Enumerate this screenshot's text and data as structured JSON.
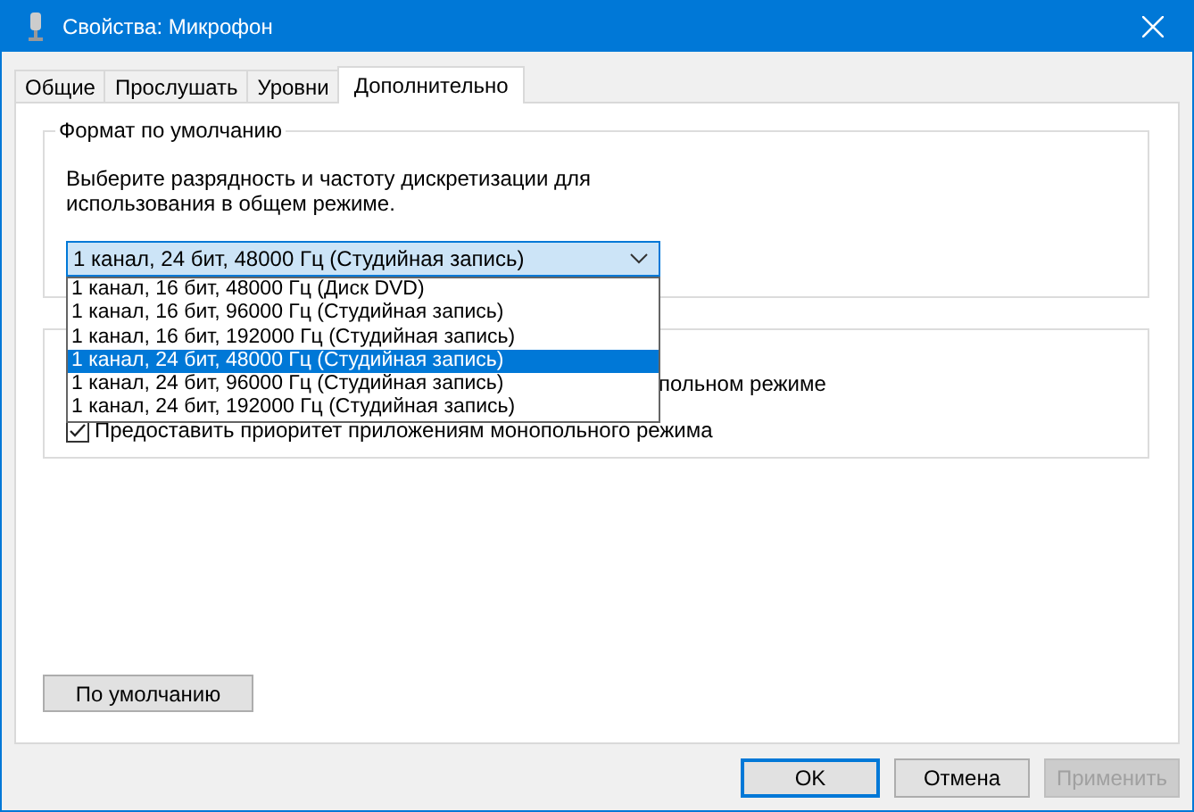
{
  "window": {
    "title": "Свойства: Микрофон"
  },
  "tabs": [
    {
      "label": "Общие",
      "selected": false
    },
    {
      "label": "Прослушать",
      "selected": false
    },
    {
      "label": "Уровни",
      "selected": false
    },
    {
      "label": "Дополнительно",
      "selected": true
    }
  ],
  "default_format": {
    "title": "Формат по умолчанию",
    "description": "Выберите разрядность и частоту дискретизации для использования в общем режиме.",
    "value": "1 канал, 24 бит, 48000 Гц (Студийная запись)",
    "expanded": true,
    "options": [
      {
        "label": "1 канал, 16 бит, 48000 Гц (Диск DVD)",
        "selected": false
      },
      {
        "label": "1 канал, 16 бит, 96000 Гц (Студийная запись)",
        "selected": false
      },
      {
        "label": "1 канал, 16 бит, 192000 Гц (Студийная запись)",
        "selected": false
      },
      {
        "label": "1 канал, 24 бит, 48000 Гц (Студийная запись)",
        "selected": true
      },
      {
        "label": "1 канал, 24 бит, 96000 Гц (Студийная запись)",
        "selected": false
      },
      {
        "label": "1 канал, 24 бит, 192000 Гц (Студийная запись)",
        "selected": false
      }
    ]
  },
  "exclusive_mode": {
    "options": [
      {
        "kind": "fragment",
        "label": "польном режиме"
      },
      {
        "kind": "checkbox",
        "label": "Предоставить приоритет приложениям монопольного режима",
        "checked": true
      }
    ]
  },
  "restore_button": {
    "label": "По умолчанию"
  },
  "buttons": [
    {
      "label": "OK",
      "default": true,
      "disabled": false
    },
    {
      "label": "Отмена",
      "default": false,
      "disabled": false
    },
    {
      "label": "Применить",
      "default": false,
      "disabled": true
    }
  ]
}
